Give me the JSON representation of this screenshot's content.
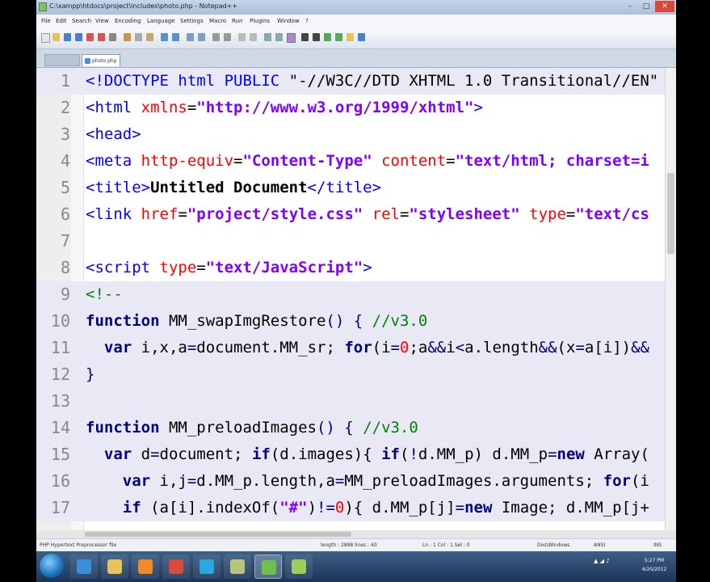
{
  "window": {
    "title": "C:\\xampp\\htdocs\\project\\includes\\photo.php - Notepad++",
    "controls": [
      "–",
      "□",
      "✕"
    ]
  },
  "menu": [
    "File",
    "Edit",
    "Search",
    "View",
    "Encoding",
    "Language",
    "Settings",
    "Macro",
    "Run",
    "Plugins",
    "Window",
    "?"
  ],
  "tabs": [
    {
      "label": "",
      "active": false
    },
    {
      "label": "photo.php",
      "active": true
    }
  ],
  "editor": {
    "lines": [
      {
        "n": "1",
        "hl": true,
        "tokens": [
          {
            "t": "<!DOCTYPE html PUBLIC ",
            "c": "k"
          },
          {
            "t": "\"-//W3C//DTD XHTML 1.0 Transitional//EN\"",
            "c": "d"
          }
        ]
      },
      {
        "n": "2",
        "hl": false,
        "tokens": [
          {
            "t": "<html ",
            "c": "tag"
          },
          {
            "t": "xmlns",
            "c": "attr"
          },
          {
            "t": "=",
            "c": "p"
          },
          {
            "t": "\"http://www.w3.org/1999/xhtml\"",
            "c": "str"
          },
          {
            "t": ">",
            "c": "tag"
          }
        ]
      },
      {
        "n": "3",
        "hl": false,
        "tokens": [
          {
            "t": "<head>",
            "c": "tag"
          }
        ]
      },
      {
        "n": "4",
        "hl": false,
        "tokens": [
          {
            "t": "<meta ",
            "c": "tag"
          },
          {
            "t": "http-equiv",
            "c": "attr"
          },
          {
            "t": "=",
            "c": "p"
          },
          {
            "t": "\"Content-Type\"",
            "c": "str"
          },
          {
            "t": " content",
            "c": "attr"
          },
          {
            "t": "=",
            "c": "p"
          },
          {
            "t": "\"text/html; charset=i",
            "c": "str"
          }
        ]
      },
      {
        "n": "5",
        "hl": false,
        "tokens": [
          {
            "t": "<title>",
            "c": "tag"
          },
          {
            "t": "Untitled Document",
            "c": "bold"
          },
          {
            "t": "</title>",
            "c": "tag"
          }
        ]
      },
      {
        "n": "6",
        "hl": false,
        "tokens": [
          {
            "t": "<link ",
            "c": "tag"
          },
          {
            "t": "href",
            "c": "attr"
          },
          {
            "t": "=",
            "c": "p"
          },
          {
            "t": "\"project/style.css\"",
            "c": "str"
          },
          {
            "t": " rel",
            "c": "attr"
          },
          {
            "t": "=",
            "c": "p"
          },
          {
            "t": "\"stylesheet\"",
            "c": "str"
          },
          {
            "t": " type",
            "c": "attr"
          },
          {
            "t": "=",
            "c": "p"
          },
          {
            "t": "\"text/cs",
            "c": "str"
          }
        ]
      },
      {
        "n": "7",
        "hl": false,
        "tokens": []
      },
      {
        "n": "8",
        "hl": false,
        "tokens": [
          {
            "t": "<script ",
            "c": "tag"
          },
          {
            "t": "type",
            "c": "attr"
          },
          {
            "t": "=",
            "c": "p"
          },
          {
            "t": "\"text/JavaScript\"",
            "c": "str"
          },
          {
            "t": ">",
            "c": "tag"
          }
        ]
      },
      {
        "n": "9",
        "hl": true,
        "tokens": [
          {
            "t": "<!--",
            "c": "cm"
          }
        ]
      },
      {
        "n": "10",
        "hl": true,
        "tokens": [
          {
            "t": "function",
            "c": "kw"
          },
          {
            "t": " MM_swapImgRestore",
            "c": "fn"
          },
          {
            "t": "() { ",
            "c": "op"
          },
          {
            "t": "//v3.0",
            "c": "cm"
          }
        ]
      },
      {
        "n": "11",
        "hl": true,
        "tokens": [
          {
            "t": "  var",
            "c": "kw"
          },
          {
            "t": " i,x,a",
            "c": "fn"
          },
          {
            "t": "=",
            "c": "op"
          },
          {
            "t": "document.MM_sr; ",
            "c": "fn"
          },
          {
            "t": "for",
            "c": "kw"
          },
          {
            "t": "(i",
            "c": "fn"
          },
          {
            "t": "=",
            "c": "op"
          },
          {
            "t": "0",
            "c": "num"
          },
          {
            "t": ";a",
            "c": "fn"
          },
          {
            "t": "&&",
            "c": "op"
          },
          {
            "t": "i",
            "c": "fn"
          },
          {
            "t": "<",
            "c": "op"
          },
          {
            "t": "a.length",
            "c": "fn"
          },
          {
            "t": "&&",
            "c": "op"
          },
          {
            "t": "(x",
            "c": "fn"
          },
          {
            "t": "=",
            "c": "op"
          },
          {
            "t": "a[i])",
            "c": "fn"
          },
          {
            "t": "&&",
            "c": "op"
          }
        ]
      },
      {
        "n": "12",
        "hl": true,
        "tokens": [
          {
            "t": "}",
            "c": "op"
          }
        ]
      },
      {
        "n": "13",
        "hl": true,
        "tokens": []
      },
      {
        "n": "14",
        "hl": true,
        "tokens": [
          {
            "t": "function",
            "c": "kw"
          },
          {
            "t": " MM_preloadImages",
            "c": "fn"
          },
          {
            "t": "() { ",
            "c": "op"
          },
          {
            "t": "//v3.0",
            "c": "cm"
          }
        ]
      },
      {
        "n": "15",
        "hl": true,
        "tokens": [
          {
            "t": "  var",
            "c": "kw"
          },
          {
            "t": " d",
            "c": "fn"
          },
          {
            "t": "=",
            "c": "op"
          },
          {
            "t": "document; ",
            "c": "fn"
          },
          {
            "t": "if",
            "c": "kw"
          },
          {
            "t": "(d.images){ ",
            "c": "fn"
          },
          {
            "t": "if",
            "c": "kw"
          },
          {
            "t": "(",
            "c": "fn"
          },
          {
            "t": "!",
            "c": "op"
          },
          {
            "t": "d.MM_p) d.MM_p",
            "c": "fn"
          },
          {
            "t": "=",
            "c": "op"
          },
          {
            "t": "new",
            "c": "kw"
          },
          {
            "t": " Array(",
            "c": "fn"
          }
        ]
      },
      {
        "n": "16",
        "hl": true,
        "tokens": [
          {
            "t": "    var",
            "c": "kw"
          },
          {
            "t": " i,j",
            "c": "fn"
          },
          {
            "t": "=",
            "c": "op"
          },
          {
            "t": "d.MM_p.length,a",
            "c": "fn"
          },
          {
            "t": "=",
            "c": "op"
          },
          {
            "t": "MM_preloadImages.arguments; ",
            "c": "fn"
          },
          {
            "t": "for",
            "c": "kw"
          },
          {
            "t": "(i",
            "c": "fn"
          }
        ]
      },
      {
        "n": "17",
        "hl": true,
        "tokens": [
          {
            "t": "    if",
            "c": "kw"
          },
          {
            "t": " (a[i].indexOf(",
            "c": "fn"
          },
          {
            "t": "\"#\"",
            "c": "str"
          },
          {
            "t": ")",
            "c": "fn"
          },
          {
            "t": "!=",
            "c": "op"
          },
          {
            "t": "0",
            "c": "num"
          },
          {
            "t": "){ d.MM_p[j]",
            "c": "fn"
          },
          {
            "t": "=",
            "c": "op"
          },
          {
            "t": "new",
            "c": "kw"
          },
          {
            "t": " Image; d.MM_p[j+",
            "c": "fn"
          }
        ]
      }
    ]
  },
  "status": {
    "filetype": "PHP Hypertext Preprocessor file",
    "length": "length : 2888   lines : 40",
    "position": "Ln : 1   Col : 1   Sel : 0",
    "eol": "Dos\\Windows",
    "encoding": "ANSI",
    "mode": "INS"
  },
  "taskbar": {
    "clock_time": "5:27 PM",
    "clock_date": "4/20/2012",
    "apps": [
      {
        "name": "ie-icon",
        "color": "#3b8fd9"
      },
      {
        "name": "explorer-icon",
        "color": "#e8c25a"
      },
      {
        "name": "media-player-icon",
        "color": "#f08a24"
      },
      {
        "name": "chrome-icon",
        "color": "#d94a3b"
      },
      {
        "name": "skype-icon",
        "color": "#29a8e0"
      },
      {
        "name": "app-icon",
        "color": "#b8c47a"
      },
      {
        "name": "notepadpp-icon",
        "color": "#6fbf4a"
      },
      {
        "name": "editor-icon",
        "color": "#9acd5a"
      }
    ]
  },
  "colors": {
    "tag": "#0000ff",
    "attr": "#ff0000",
    "str": "#8000ff",
    "kw": "#000080",
    "fn": "#000000",
    "op": "#000080",
    "cm": "#008000",
    "num": "#ff0000",
    "bold": "#000000",
    "k": "#0000ff",
    "d": "#000000",
    "p": "#000000"
  }
}
